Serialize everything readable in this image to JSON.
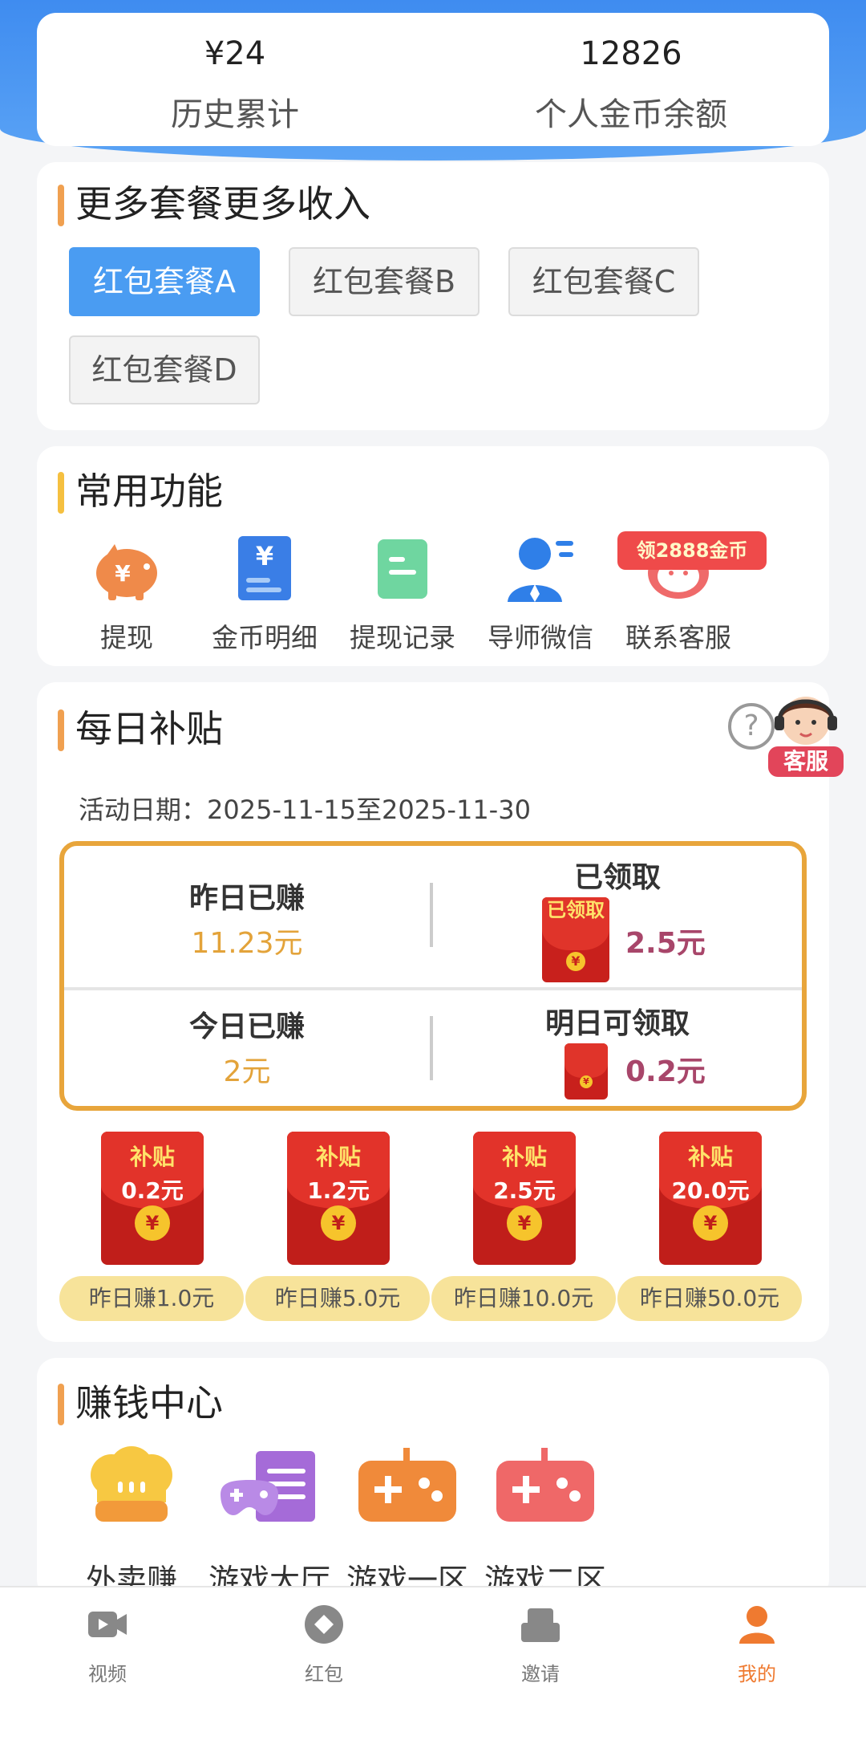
{
  "stats": {
    "history_value": "¥24",
    "history_label": "历史累计",
    "coins_value": "12826",
    "coins_label": "个人金币余额"
  },
  "packages": {
    "title": "更多套餐更多收入",
    "items": [
      "红包套餐A",
      "红包套餐B",
      "红包套餐C",
      "红包套餐D"
    ],
    "selected": "红包套餐A"
  },
  "functions": {
    "title": "常用功能",
    "items": [
      "提现",
      "金币明细",
      "提现记录",
      "导师微信",
      "联系客服"
    ],
    "badge": "领2888金币"
  },
  "daily": {
    "title": "每日补贴",
    "date_line": "活动日期：2025-11-15至2025-11-30",
    "service_label": "客服",
    "yesterday_label": "昨日已赚",
    "yesterday_value": "11.23元",
    "claimed_label": "已领取",
    "claimed_env_text": "已领取",
    "claimed_value": "2.5元",
    "today_label": "今日已赚",
    "today_value": "2元",
    "tomorrow_label": "明日可领取",
    "tomorrow_value": "0.2元",
    "subsidies": [
      {
        "title": "补贴",
        "amount": "0.2元",
        "condition": "昨日赚1.0元"
      },
      {
        "title": "补贴",
        "amount": "1.2元",
        "condition": "昨日赚5.0元"
      },
      {
        "title": "补贴",
        "amount": "2.5元",
        "condition": "昨日赚10.0元"
      },
      {
        "title": "补贴",
        "amount": "20.0元",
        "condition": "昨日赚50.0元"
      }
    ],
    "coin_symbol": "¥"
  },
  "earn": {
    "title": "赚钱中心",
    "items": [
      "外卖赚",
      "游戏大厅",
      "游戏一区",
      "游戏二区"
    ]
  },
  "tabbar": {
    "items": [
      "视频",
      "红包",
      "邀请",
      "我的"
    ],
    "active": "我的"
  },
  "colors": {
    "primary_blue": "#4a9cf2",
    "accent_orange": "#ef7a30",
    "gold": "#e8a53b",
    "red": "#c01e1a"
  }
}
